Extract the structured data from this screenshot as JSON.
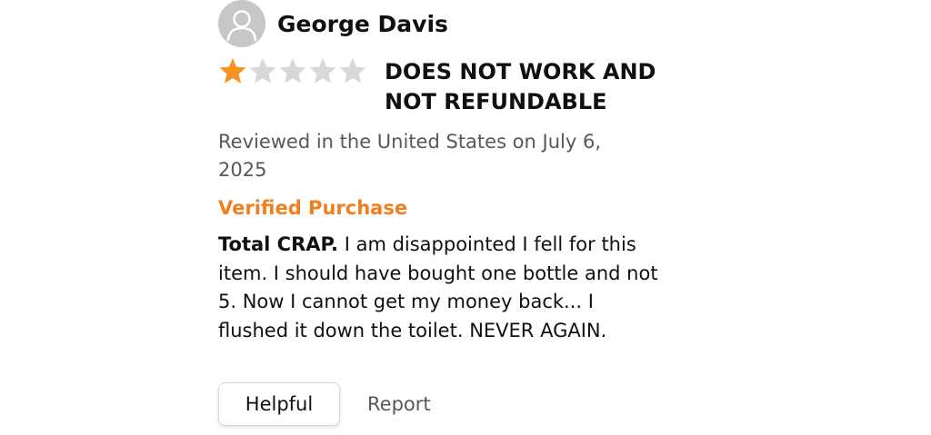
{
  "reviewer": {
    "name": "George Davis",
    "avatar_icon": "user-silhouette-icon"
  },
  "rating": {
    "value": 1,
    "max": 5,
    "filled_color": "#f7921e",
    "empty_color": "#d8d8d8"
  },
  "review": {
    "title": "DOES NOT WORK AND NOT REFUNDABLE",
    "meta": "Reviewed in the United States on July 6, 2025",
    "verified_label": "Verified Purchase",
    "body_lead": "Total CRAP.",
    "body_text": " I am disappointed I fell for this item. I should have bought one bottle and not 5. Now I cannot get my money back... I flushed it down the toilet. NEVER AGAIN."
  },
  "actions": {
    "helpful_label": "Helpful",
    "report_label": "Report"
  },
  "colors": {
    "accent_orange": "#f0801f",
    "meta_gray": "#565959",
    "text": "#0f1111"
  }
}
